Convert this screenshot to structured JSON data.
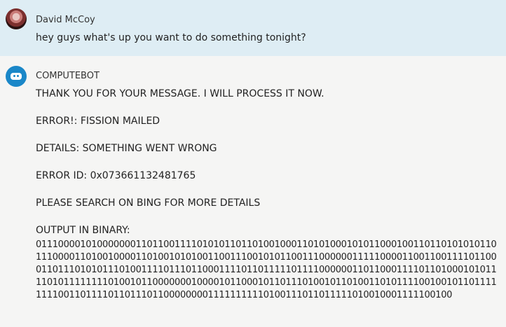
{
  "messages": {
    "user": {
      "name": "David McCoy",
      "text": "hey guys what's up you want to do something tonight?",
      "avatar": "profile-photo"
    },
    "bot": {
      "name": "COMPUTEBOT",
      "avatar": "robot-icon",
      "lines": [
        "THANK YOU FOR YOUR MESSAGE. I WILL PROCESS IT NOW.",
        "ERROR!: FISSION MAILED",
        "DETAILS: SOMETHING WENT WRONG",
        "ERROR ID: 0x073661132481765",
        "PLEASE SEARCH ON BING FOR MORE DETAILS",
        "OUTPUT IN BINARY:"
      ],
      "binary": "01110000101000000011011001111010101101101001000110101000101011000100110110101010110111000011010010000110100101010011001110010101100111000000111110000110011001111011000110111010101110100111101110110001111011011111011110000001101100011110110100010101111010111111110100101100000001000010110001011011101001011010011010111100100101101111111100110111101101110110000000011111111110100111011011111010010001111100100"
    }
  },
  "colors": {
    "user_bg": "#deedf4",
    "bot_bg": "#f5f5f4",
    "bot_avatar": "#1a87c8"
  }
}
